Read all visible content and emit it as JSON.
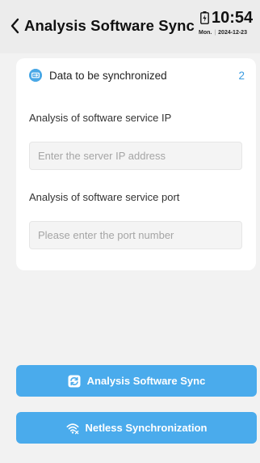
{
  "header": {
    "title": "Analysis Software Sync",
    "time": "10:54",
    "weekday": "Mon.",
    "date_separator": "|",
    "date": "2024-12-23"
  },
  "card": {
    "heading": "Data to be synchronized",
    "count": "2",
    "ip_label": "Analysis of software service IP",
    "ip_placeholder": "Enter the server IP address",
    "ip_value": "",
    "port_label": "Analysis of software service port",
    "port_placeholder": "Please enter the port number",
    "port_value": ""
  },
  "buttons": {
    "sync_label": "Analysis Software Sync",
    "netless_label": "Netless Synchronization"
  },
  "colors": {
    "accent": "#4aabec",
    "count": "#3a9be0",
    "card_bg": "#ffffff",
    "page_bg": "#f2f2f2"
  },
  "icons": {
    "back": "chevron-left-icon",
    "battery": "battery-charging-icon",
    "card_heading": "sync-data-icon",
    "sync_button": "sync-icon",
    "netless_button": "wifi-icon"
  }
}
